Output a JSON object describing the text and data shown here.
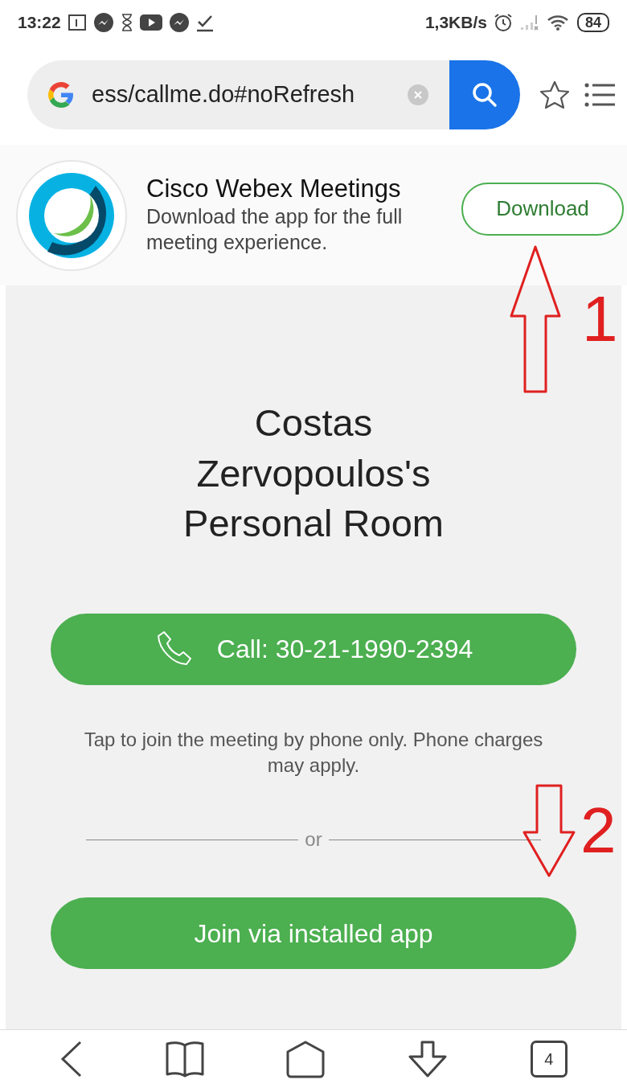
{
  "status_bar": {
    "time": "13:22",
    "speed": "1,3KB/s",
    "battery": "84"
  },
  "address_bar": {
    "url": "ess/callme.do#noRefresh"
  },
  "app_banner": {
    "title": "Cisco Webex Meetings",
    "description": "Download the app for the full meeting experience.",
    "button": "Download"
  },
  "meeting": {
    "title": "Costas Zervopoulos's Personal Room",
    "call_button": "Call: 30-21-1990-2394",
    "call_note": "Tap to join the meeting by phone only. Phone charges may apply.",
    "divider": "or",
    "join_button": "Join via installed app"
  },
  "nav_bar": {
    "tab_count": "4"
  },
  "annotations": [
    {
      "kind": "arrow_up",
      "label": "1"
    },
    {
      "kind": "arrow_down",
      "label": "2"
    }
  ]
}
